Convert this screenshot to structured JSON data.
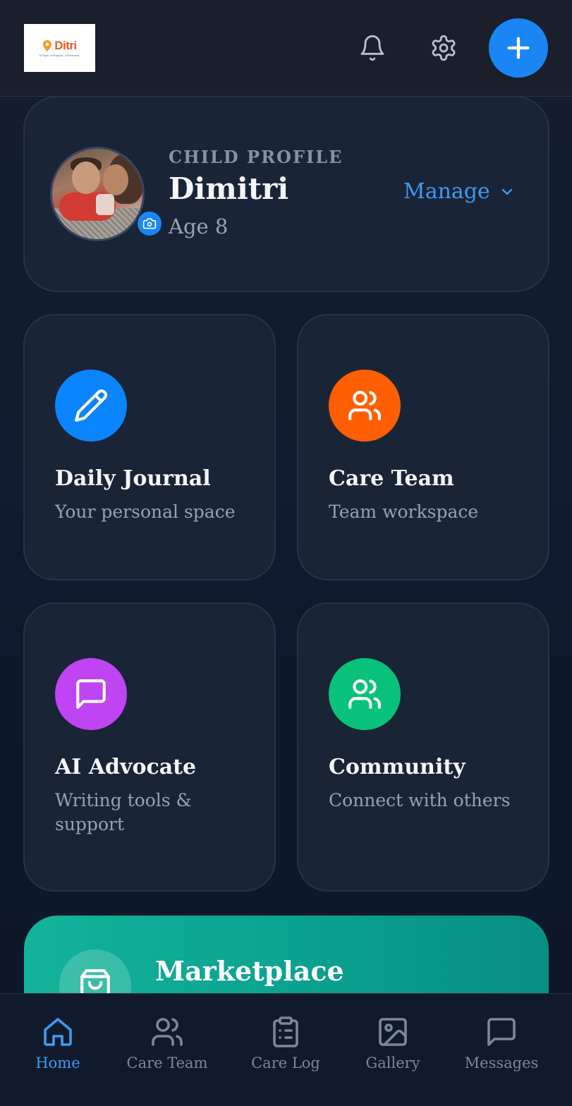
{
  "header": {
    "logo_text": "Ditri",
    "logo_tagline": "A Place. A Purpose. A Presence.",
    "bell_icon": "bell-icon",
    "settings_icon": "gear-icon",
    "add_icon": "plus-icon",
    "accent": "#1a86f5"
  },
  "profile": {
    "kicker": "CHILD PROFILE",
    "name": "Dimitri",
    "age": "Age 8",
    "manage_label": "Manage"
  },
  "tiles": [
    {
      "title": "Daily Journal",
      "subtitle": "Your personal space",
      "icon": "pencil-icon",
      "color": "#0a84ff"
    },
    {
      "title": "Care Team",
      "subtitle": "Team workspace",
      "icon": "users-icon",
      "color": "#ff5f00"
    },
    {
      "title": "AI Advocate",
      "subtitle": "Writing tools & support",
      "icon": "message-icon",
      "color": "#bf44f2"
    },
    {
      "title": "Community",
      "subtitle": "Connect with others",
      "icon": "users-icon",
      "color": "#08c17a"
    }
  ],
  "marketplace": {
    "title": "Marketplace",
    "icon": "shopping-bag-icon"
  },
  "nav": [
    {
      "label": "Home",
      "icon": "home-icon",
      "active": true
    },
    {
      "label": "Care Team",
      "icon": "users-icon",
      "active": false
    },
    {
      "label": "Care Log",
      "icon": "clipboard-icon",
      "active": false
    },
    {
      "label": "Gallery",
      "icon": "image-icon",
      "active": false
    },
    {
      "label": "Messages",
      "icon": "message-icon",
      "active": false
    }
  ]
}
